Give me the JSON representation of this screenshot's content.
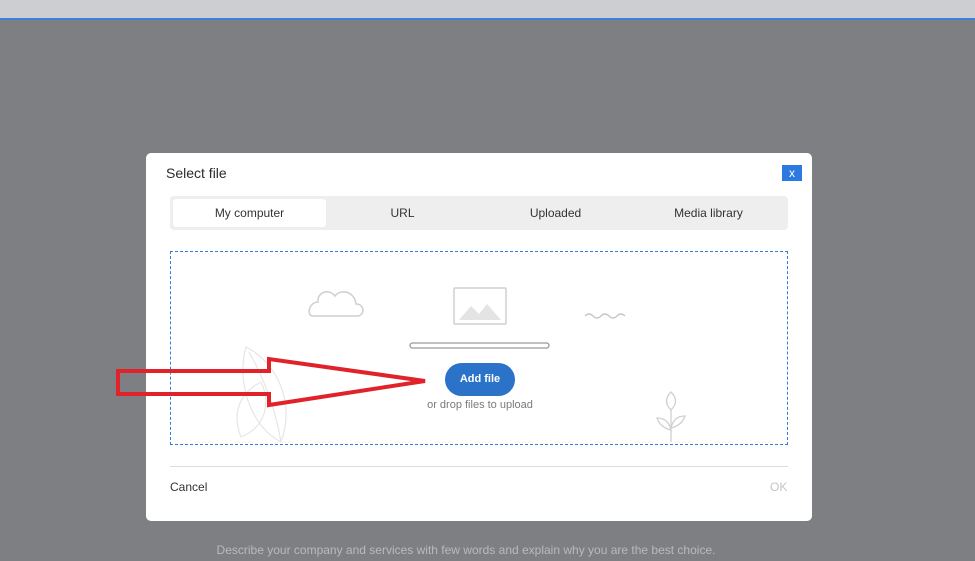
{
  "dialog": {
    "title": "Select file",
    "close_label": "x",
    "tabs": [
      {
        "label": "My computer",
        "active": true
      },
      {
        "label": "URL",
        "active": false
      },
      {
        "label": "Uploaded",
        "active": false
      },
      {
        "label": "Media library",
        "active": false
      }
    ],
    "dropzone": {
      "add_file_label": "Add file",
      "drop_text": "or drop files to upload"
    },
    "cancel_label": "Cancel",
    "ok_label": "OK"
  },
  "background": {
    "footer_text": "Describe your company and services with few words and explain why you are the best choice."
  },
  "colors": {
    "overlay": "#7e7f83",
    "accent": "#2c7ae0",
    "annotation_arrow": "#e0232a"
  },
  "icons": [
    "cloud-icon",
    "image-icon",
    "wave-icon",
    "leaf-icon",
    "sprout-icon",
    "close-icon"
  ]
}
